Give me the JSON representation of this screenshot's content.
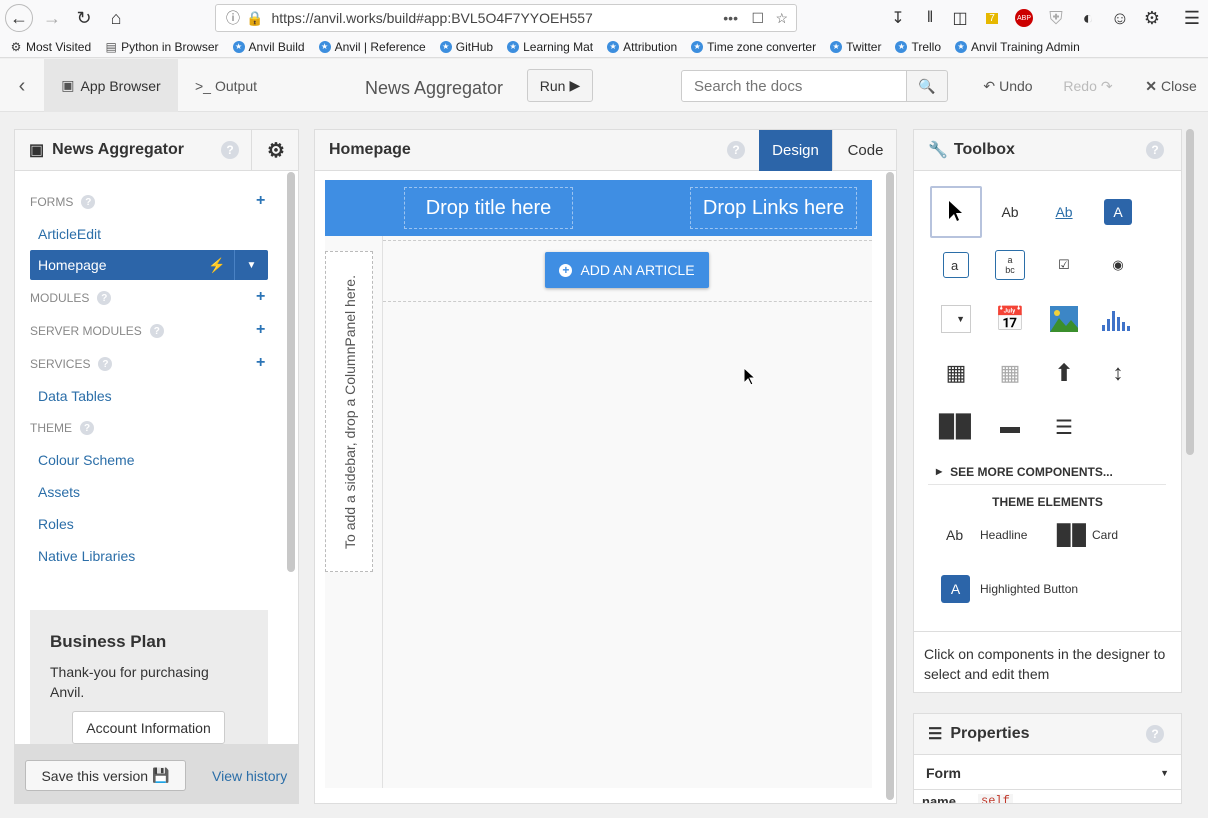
{
  "browser": {
    "url": "https://anvil.works/build#app:BVL5O4F7YYOEH557",
    "bookmarks": [
      "Most Visited",
      "Python in Browser",
      "Anvil Build",
      "Anvil | Reference",
      "GitHub",
      "Learning Mat",
      "Attribution",
      "Time zone converter",
      "Twitter",
      "Trello",
      "Anvil Training Admin"
    ],
    "badge_count": "7"
  },
  "header": {
    "app_browser": "App Browser",
    "output": "Output",
    "app_title": "News Aggregator",
    "run": "Run",
    "search_placeholder": "Search the docs",
    "undo": "Undo",
    "redo": "Redo",
    "close": "Close"
  },
  "left": {
    "title": "News Aggregator",
    "forms_label": "FORMS",
    "forms": [
      "ArticleEdit",
      "Homepage"
    ],
    "modules_label": "MODULES",
    "server_modules_label": "SERVER MODULES",
    "services_label": "SERVICES",
    "services": [
      "Data Tables"
    ],
    "theme_label": "THEME",
    "theme": [
      "Colour Scheme",
      "Assets",
      "Roles",
      "Native Libraries"
    ],
    "plan_title": "Business Plan",
    "plan_text": "Thank-you for purchasing Anvil.",
    "account_btn": "Account Information",
    "save_btn": "Save this version",
    "history": "View history"
  },
  "designer": {
    "title": "Homepage",
    "tab_design": "Design",
    "tab_code": "Code",
    "drop_title": "Drop title here",
    "drop_links": "Drop Links here",
    "add_article": "ADD AN ARTICLE",
    "sidebar_hint": "To add a sidebar, drop a ColumnPanel here."
  },
  "toolbox": {
    "title": "Toolbox",
    "see_more": "SEE MORE COMPONENTS...",
    "theme_elements": "THEME ELEMENTS",
    "headline": "Headline",
    "card": "Card",
    "highlighted": "Highlighted Button",
    "hint": "Click on components in the designer to select and edit them"
  },
  "properties": {
    "title": "Properties",
    "form": "Form",
    "name_label": "name",
    "name_value": "self"
  },
  "colors": {
    "accent": "#3f8ee3",
    "dark_blue": "#2c65a9",
    "link": "#2b6ea8"
  }
}
